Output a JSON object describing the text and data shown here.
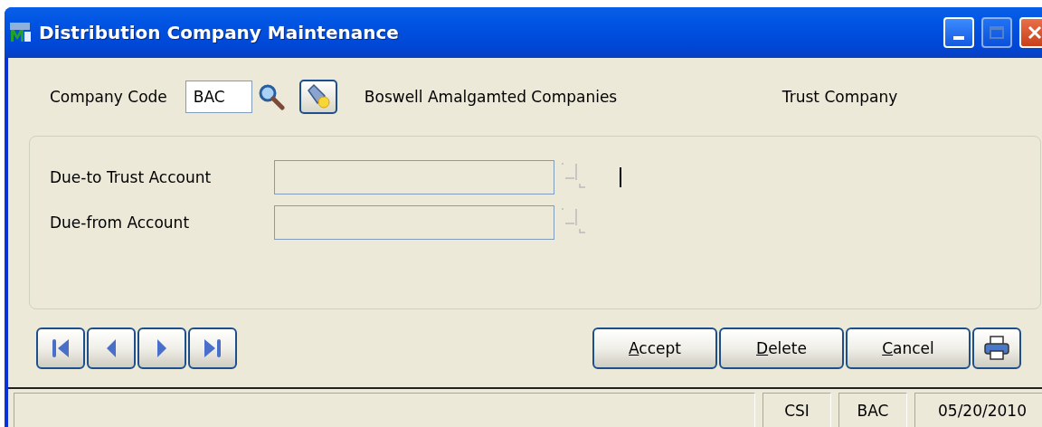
{
  "window": {
    "title": "Distribution Company Maintenance"
  },
  "header": {
    "company_code_label": "Company Code",
    "company_code": "BAC",
    "company_name": "Boswell Amalgamted Companies",
    "company_type": "Trust Company"
  },
  "fields": [
    {
      "label": "Due-to Trust Account",
      "focused": true
    },
    {
      "label": "Due-from Account",
      "focused": false
    }
  ],
  "navigation": [
    {
      "kind": "first"
    },
    {
      "kind": "previous"
    },
    {
      "kind": "next"
    },
    {
      "kind": "last"
    }
  ],
  "buttons": [
    "Accept",
    "Delete",
    "Cancel"
  ],
  "status_bar": [
    "CSI",
    "BAC",
    "05/20/2010"
  ]
}
